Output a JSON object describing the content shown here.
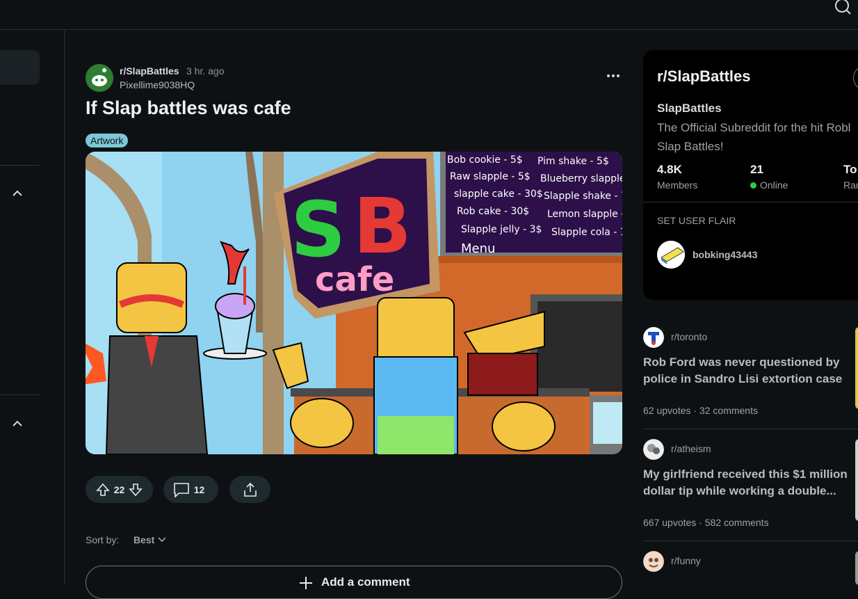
{
  "post": {
    "subreddit": "r/SlapBattles",
    "time": "3 hr. ago",
    "author": "Pixellime9038HQ",
    "title": "If Slap battles was cafe",
    "flair": "Artwork",
    "image": {
      "logo_top": "SB",
      "logo_bottom": "cafe",
      "menu_left": [
        "Bob cookie - 5$",
        "Raw slapple - 5$",
        "slapple cake - 30$",
        "Rob cake - 30$",
        "Slapple jelly - 3$"
      ],
      "menu_right": [
        "Pim shake - 5$",
        "Blueberry slapple -",
        "Slapple shake - 7",
        "Lemon slapple -",
        "Slapple cola - 1"
      ],
      "menu_label": "Menu"
    },
    "votes": "22",
    "comments": "12",
    "sort_label": "Sort by:",
    "sort_value": "Best",
    "add_comment": "Add a comment"
  },
  "sidebar": {
    "title": "r/SlapBattles",
    "name": "SlapBattles",
    "description": [
      "The Official Subreddit for the hit Robl",
      "Slap Battles!"
    ],
    "stats": [
      {
        "value": "4.8K",
        "label": "Members"
      },
      {
        "value": "21",
        "label": "Online"
      },
      {
        "value": "To",
        "label": "Ran"
      }
    ],
    "flair_heading": "SET USER FLAIR",
    "flair_user": "bobking43443"
  },
  "recommended": [
    {
      "subreddit": "r/toronto",
      "title": "Rob Ford was never questioned by police in Sandro Lisi extortion case",
      "upvotes": "62 upvotes",
      "comments": "32 comments",
      "accent": "#e0c64a"
    },
    {
      "subreddit": "r/atheism",
      "title": "My girlfriend received this $1 million dollar tip while working a double...",
      "upvotes": "667 upvotes",
      "comments": "582 comments",
      "accent": "#cfcfcf"
    },
    {
      "subreddit": "r/funny",
      "title": "",
      "upvotes": "",
      "comments": "",
      "accent": "#9a9a9a"
    }
  ],
  "colors": {
    "background": "#0e1113",
    "accent_flair": "#7cc7d8",
    "online": "#2ecc40"
  }
}
